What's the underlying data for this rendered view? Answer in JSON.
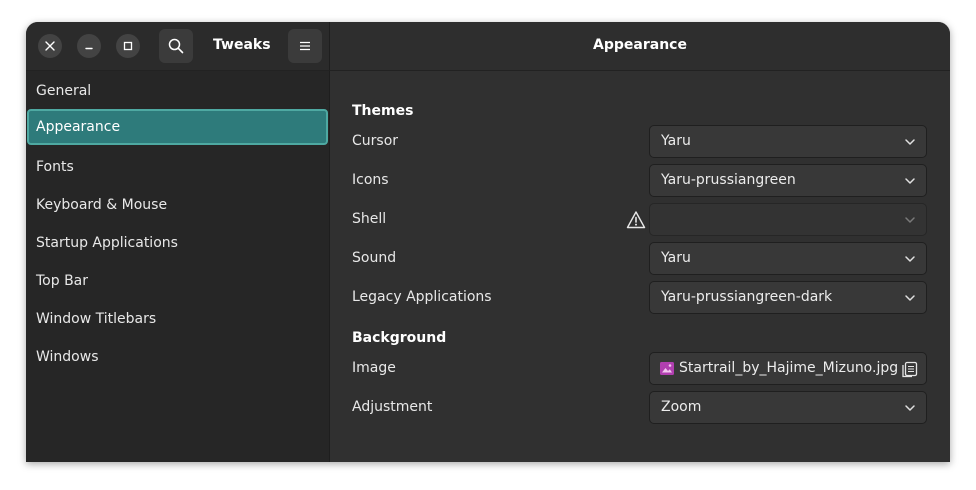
{
  "app": {
    "title": "Tweaks",
    "page_title": "Appearance"
  },
  "window_controls": {
    "close_icon": "close-icon",
    "minimize_icon": "minimize-icon",
    "maximize_icon": "maximize-icon"
  },
  "header": {
    "search_icon": "search-icon",
    "menu_icon": "hamburger-menu-icon"
  },
  "sidebar": {
    "items": [
      {
        "label": "General"
      },
      {
        "label": "Appearance",
        "selected": true
      },
      {
        "label": "Fonts"
      },
      {
        "label": "Keyboard & Mouse"
      },
      {
        "label": "Startup Applications"
      },
      {
        "label": "Top Bar"
      },
      {
        "label": "Window Titlebars"
      },
      {
        "label": "Windows"
      }
    ]
  },
  "themes": {
    "title": "Themes",
    "rows": [
      {
        "label": "Cursor",
        "value": "Yaru"
      },
      {
        "label": "Icons",
        "value": "Yaru-prussiangreen"
      },
      {
        "label": "Shell",
        "value": "",
        "warning": true
      },
      {
        "label": "Sound",
        "value": "Yaru"
      },
      {
        "label": "Legacy Applications",
        "value": "Yaru-prussiangreen-dark"
      }
    ]
  },
  "background": {
    "title": "Background",
    "image": {
      "label": "Image",
      "value": "Startrail_by_Hajime_Mizuno.jpg"
    },
    "adjustment": {
      "label": "Adjustment",
      "value": "Zoom"
    }
  },
  "colors": {
    "accent": "#2e7b7b",
    "accent_border": "#4ea9a2",
    "window_bg": "#303030",
    "sidebar_bg": "#262626"
  }
}
